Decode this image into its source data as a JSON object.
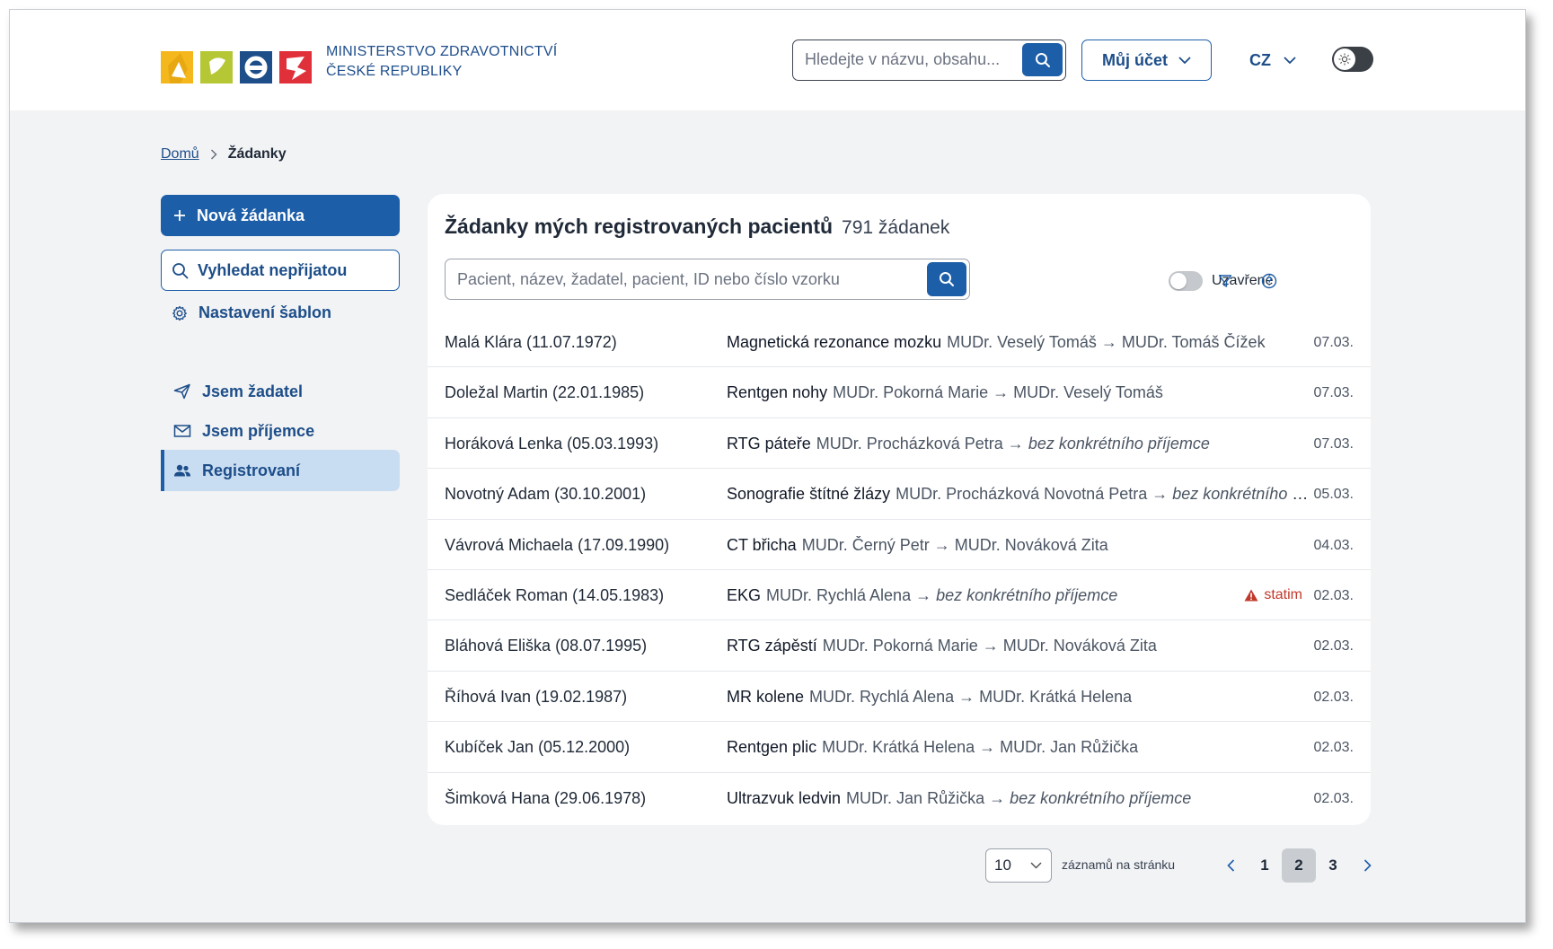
{
  "header": {
    "logo_line1": "MINISTERSTVO ZDRAVOTNICTVÍ",
    "logo_line2": "ČESKÉ REPUBLIKY",
    "search_placeholder": "Hledejte v názvu, obsahu...",
    "account_label": "Můj účet",
    "language": "CZ",
    "brand_blue": "#1d5ea8"
  },
  "breadcrumb": {
    "home": "Domů",
    "current": "Žádanky"
  },
  "sidebar": {
    "new_request": "Nová žádanka",
    "search_unaccepted": "Vyhledat nepřijatou",
    "template_settings": "Nastavení šablon",
    "nav": [
      {
        "label": "Jsem žadatel",
        "icon": "send-icon",
        "active": false
      },
      {
        "label": "Jsem příjemce",
        "icon": "envelope-icon",
        "active": false
      },
      {
        "label": "Registrovaní",
        "icon": "users-icon",
        "active": true
      }
    ]
  },
  "main": {
    "title": "Žádanky mých registrovaných pacientů",
    "count": "791 žádanek",
    "search_placeholder": "Pacient, název, žadatel, pacient, ID nebo číslo vzorku",
    "closed_toggle_label": "Uzavřené",
    "rows": [
      {
        "patient": "Malá Klára (11.07.1972)",
        "exam": "Magnetická rezonance mozku",
        "from": "MUDr. Veselý Tomáš",
        "to": "MUDr. Tomáš Čížek",
        "to_italic": false,
        "statim": "",
        "date": "07.03."
      },
      {
        "patient": "Doležal Martin (22.01.1985)",
        "exam": "Rentgen nohy",
        "from": "MUDr. Pokorná Marie",
        "to": "MUDr. Veselý Tomáš",
        "to_italic": false,
        "statim": "",
        "date": "07.03."
      },
      {
        "patient": "Horáková Lenka (05.03.1993)",
        "exam": "RTG páteře",
        "from": "MUDr. Procházková Petra",
        "to": "bez konkrétního příjemce",
        "to_italic": true,
        "statim": "",
        "date": "07.03."
      },
      {
        "patient": "Novotný Adam (30.10.2001)",
        "exam": "Sonografie štítné žlázy",
        "from": "MUDr. Procházková Novotná Petra",
        "to": "bez konkrétního příjemce",
        "to_italic": true,
        "statim": "",
        "date": "05.03."
      },
      {
        "patient": "Vávrová Michaela (17.09.1990)",
        "exam": "CT břicha",
        "from": "MUDr. Černý Petr",
        "to": "MUDr. Nováková Zita",
        "to_italic": false,
        "statim": "",
        "date": "04.03."
      },
      {
        "patient": "Sedláček Roman (14.05.1983)",
        "exam": "EKG",
        "from": "MUDr. Rychlá Alena",
        "to": "bez konkrétního příjemce",
        "to_italic": true,
        "statim": "statim",
        "date": "02.03."
      },
      {
        "patient": "Bláhová Eliška (08.07.1995)",
        "exam": "RTG zápěstí",
        "from": "MUDr. Pokorná Marie",
        "to": "MUDr. Nováková Zita",
        "to_italic": false,
        "statim": "",
        "date": "02.03."
      },
      {
        "patient": "Říhová Ivan (19.02.1987)",
        "exam": "MR kolene",
        "from": "MUDr. Rychlá Alena",
        "to": "MUDr. Krátká Helena",
        "to_italic": false,
        "statim": "",
        "date": "02.03."
      },
      {
        "patient": "Kubíček Jan (05.12.2000)",
        "exam": "Rentgen plic",
        "from": "MUDr. Krátká Helena",
        "to": "MUDr. Jan Růžička",
        "to_italic": false,
        "statim": "",
        "date": "02.03."
      },
      {
        "patient": "Šimková Hana (29.06.1978)",
        "exam": "Ultrazvuk ledvin",
        "from": "MUDr. Jan Růžička",
        "to": "bez konkrétního příjemce",
        "to_italic": true,
        "statim": "",
        "date": "02.03."
      }
    ]
  },
  "pagination": {
    "per_page": "10",
    "per_page_label": "záznamů na stránku",
    "pages": [
      "1",
      "2",
      "3"
    ],
    "current_page": "2"
  }
}
